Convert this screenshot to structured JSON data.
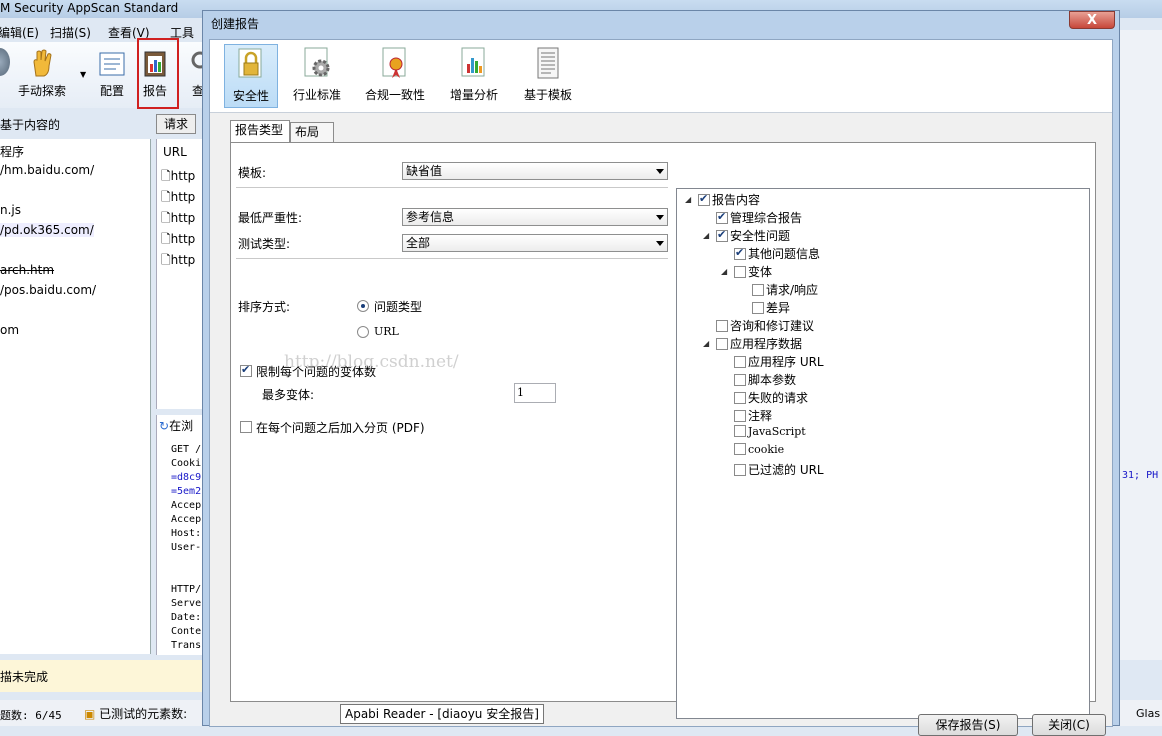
{
  "app": {
    "title": "M Security AppScan Standard",
    "menu": [
      "编辑(E)",
      "扫描(S)",
      "查看(V)",
      "工具(T)"
    ],
    "toolbar": [
      "手动探索",
      "配置",
      "报告",
      "查"
    ],
    "left_header": "基于内容的",
    "request_button": "请求",
    "url_header": "URL",
    "left_items": [
      "程序",
      "/hm.baidu.com/",
      "n.js",
      "/pd.ok365.com/",
      "arch.htm",
      "/pos.baidu.com/",
      "om"
    ],
    "url_items": [
      "http",
      "http",
      "http",
      "http",
      "http"
    ],
    "browser_tab": "在浏",
    "request_lines": [
      "GET /",
      "Cooki",
      "=d8c9",
      "=5em2",
      "Accep",
      "Accep",
      "Host:",
      "User-",
      "",
      "HTTP/",
      "Serve",
      "Date:",
      "Conte",
      "Trans"
    ],
    "right_fragment": "31; PH",
    "status_text": "描未完成",
    "bottom_left": "题数: 6/45",
    "bottom_mid": "已测试的元素数:",
    "bottom_right": "Glas"
  },
  "dialog": {
    "title": "创建报告",
    "close_label": "X",
    "categories": [
      "安全性",
      "行业标准",
      "合规一致性",
      "增量分析",
      "基于模板"
    ],
    "selected_category": "安全性",
    "tabs": [
      "报告类型",
      "布局"
    ],
    "template_label": "模板:",
    "template_value": "缺省值",
    "min_severity_label": "最低严重性:",
    "min_severity_value": "参考信息",
    "test_type_label": "测试类型:",
    "test_type_value": "全部",
    "sort_label": "排序方式:",
    "sort_options": [
      "问题类型",
      "URL"
    ],
    "sort_selected": "问题类型",
    "limit_variants_label": "限制每个问题的变体数",
    "limit_variants_checked": true,
    "max_variants_label": "最多变体:",
    "max_variants_value": "1",
    "page_break_label": "在每个问题之后加入分页 (PDF)",
    "page_break_checked": false,
    "tree": [
      {
        "label": "报告内容",
        "checked": true
      },
      {
        "label": "管理综合报告",
        "checked": true
      },
      {
        "label": "安全性问题",
        "checked": true
      },
      {
        "label": "其他问题信息",
        "checked": true
      },
      {
        "label": "变体",
        "checked": false
      },
      {
        "label": "请求/响应",
        "checked": false
      },
      {
        "label": "差异",
        "checked": false
      },
      {
        "label": "咨询和修订建议",
        "checked": false
      },
      {
        "label": "应用程序数据",
        "checked": false
      },
      {
        "label": "应用程序 URL",
        "checked": false
      },
      {
        "label": "脚本参数",
        "checked": false
      },
      {
        "label": "失败的请求",
        "checked": false
      },
      {
        "label": "注释",
        "checked": false
      },
      {
        "label": "JavaScript",
        "checked": false
      },
      {
        "label": "cookie",
        "checked": false
      },
      {
        "label": "已过滤的 URL",
        "checked": false
      }
    ],
    "save_button": "保存报告(S)",
    "close_button": "关闭(C)"
  },
  "watermark": "http://blog.csdn.net/",
  "tooltip": "Apabi Reader - [diaoyu 安全报告]"
}
